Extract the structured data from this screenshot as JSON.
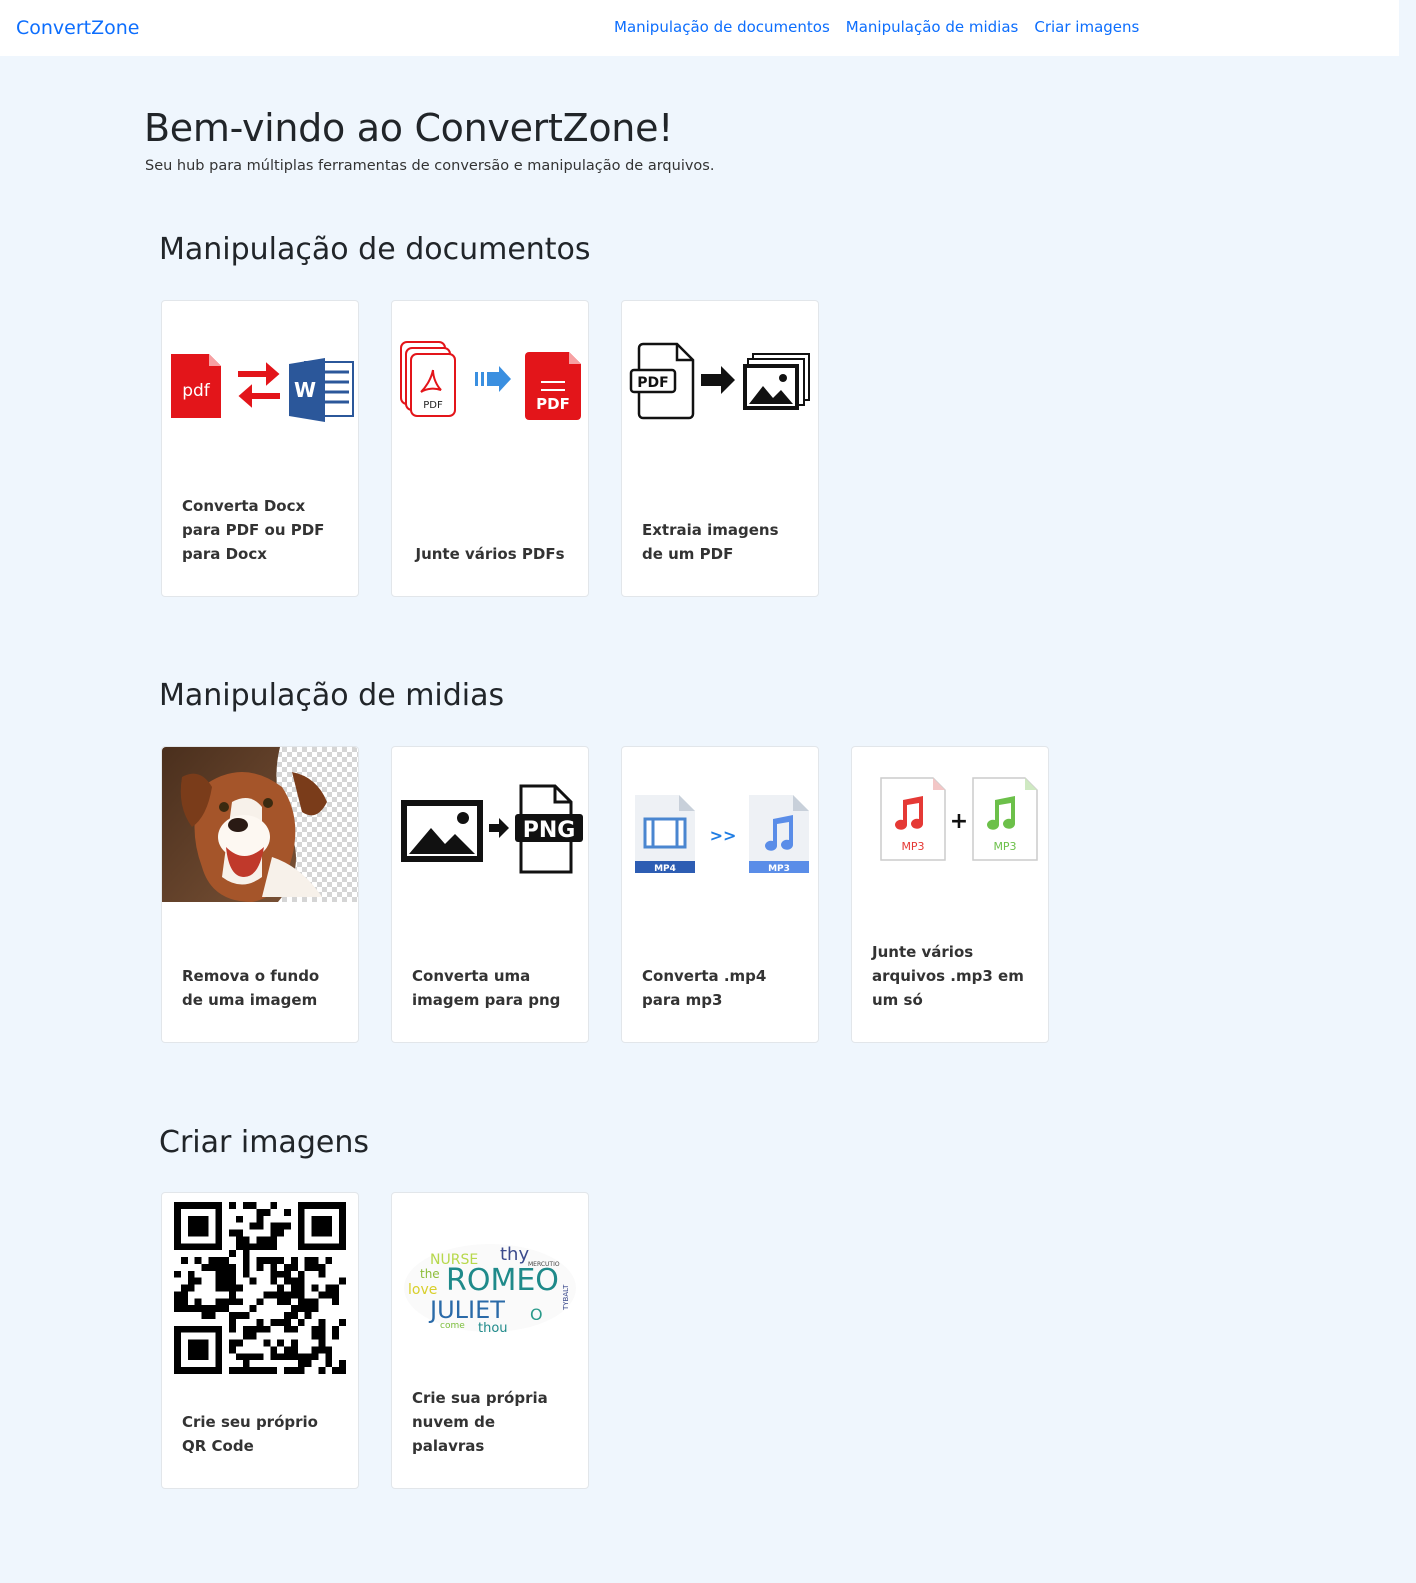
{
  "nav": {
    "brand": "ConvertZone",
    "links": [
      "Manipulação de documentos",
      "Manipulação de midias",
      "Criar imagens"
    ]
  },
  "hero": {
    "title": "Bem-vindo ao ConvertZone!",
    "subtitle": "Seu hub para múltiplas ferramentas de conversão e manipulação de arquivos."
  },
  "sections": [
    {
      "title": "Manipulação de documentos",
      "cards": [
        {
          "label": "Converta Docx para PDF ou PDF para Docx",
          "icon": "pdf-word-convert-icon",
          "icon_text_pdf": "pdf",
          "icon_text_word": "W"
        },
        {
          "label": "Junte vários PDFs",
          "icon": "merge-pdf-icon",
          "icon_text_a": "PDF",
          "icon_text_b": "PDF"
        },
        {
          "label": "Extraia imagens de um PDF",
          "icon": "pdf-to-images-icon",
          "icon_text": "PDF"
        }
      ]
    },
    {
      "title": "Manipulação de midias",
      "cards": [
        {
          "label": "Remova o fundo de uma imagem",
          "icon": "dog-photo-icon"
        },
        {
          "label": "Converta uma imagem para png",
          "icon": "image-to-png-icon",
          "icon_text": "PNG"
        },
        {
          "label": "Converta .mp4 para  mp3",
          "icon": "mp4-to-mp3-icon",
          "icon_text_a": "MP4",
          "icon_text_arrow": ">>",
          "icon_text_b": "MP3"
        },
        {
          "label": "Junte vários arquivos .mp3 em um só",
          "icon": "merge-mp3-icon",
          "icon_text_a": "MP3",
          "icon_text_b": "MP3"
        }
      ]
    },
    {
      "title": "Criar imagens",
      "cards": [
        {
          "label": "Crie seu próprio QR Code",
          "icon": "qr-code-icon"
        },
        {
          "label": "Crie sua própria nuvem de palavras",
          "icon": "word-cloud-icon",
          "cloud_words": [
            "NURSE",
            "thy",
            "the",
            "ROMEO",
            "love",
            "JULIET",
            "O",
            "thou",
            "come",
            "MERCUTIO",
            "TYBALT"
          ]
        }
      ]
    }
  ],
  "colors": {
    "link": "#0d6efd",
    "background": "#eff6fd"
  }
}
